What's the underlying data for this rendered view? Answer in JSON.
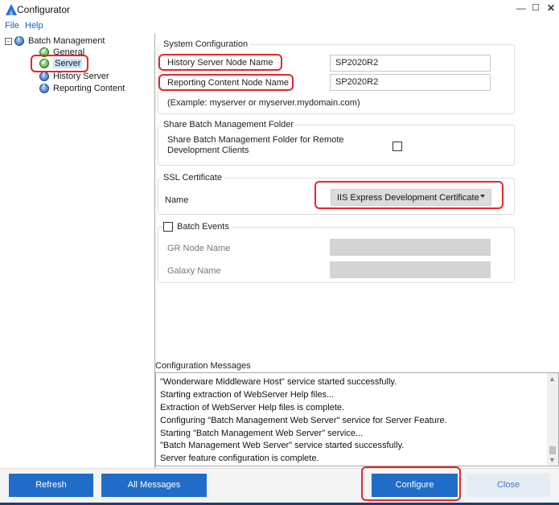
{
  "window": {
    "title": "Configurator",
    "minimize_glyph": "—",
    "maximize_glyph": "☐",
    "close_glyph": "✕"
  },
  "menu": {
    "items": [
      "File",
      "Help"
    ]
  },
  "tree": {
    "root": {
      "label": "Batch Management",
      "expander": "⊟",
      "icon": "info-icon"
    },
    "children": [
      {
        "label": "General",
        "icon": "check-icon"
      },
      {
        "label": "Server",
        "icon": "check-icon",
        "selected": true
      },
      {
        "label": "History Server",
        "icon": "info-icon"
      },
      {
        "label": "Reporting Content",
        "icon": "info-icon"
      }
    ]
  },
  "system_config": {
    "title": "System Configuration",
    "history_label": "History Server Node Name",
    "history_value": "SP2020R2",
    "reporting_label": "Reporting Content Node Name",
    "reporting_value": "SP2020R2",
    "example": "(Example: myserver or myserver.mydomain.com)"
  },
  "share_folder": {
    "title": "Share Batch Management Folder",
    "label": "Share Batch Management Folder for Remote Development Clients",
    "checked": false
  },
  "ssl": {
    "title": "SSL Certificate",
    "name_label": "Name",
    "selected": "IIS Express Development Certificate"
  },
  "batch_events": {
    "title": "Batch Events",
    "checked": false,
    "gr_node_label": "GR Node Name",
    "galaxy_label": "Galaxy Name"
  },
  "messages": {
    "title": "Configuration Messages",
    "lines": [
      "\"Wonderware Middleware Host\" service started successfully.",
      "Starting extraction of WebServer Help files...",
      "Extraction of WebServer Help files is complete.",
      "Configuring \"Batch Management Web Server\" service for Server Feature.",
      "Starting \"Batch Management Web Server\" service...",
      "\"Batch Management Web Server\" service started successfully.",
      "Server feature configuration is complete."
    ]
  },
  "buttons": {
    "refresh": "Refresh",
    "all_messages": "All Messages",
    "configure": "Configure",
    "close": "Close"
  },
  "colors": {
    "accent": "#1f6dc8",
    "highlight": "#e0282e",
    "selection": "#cce4f7"
  }
}
